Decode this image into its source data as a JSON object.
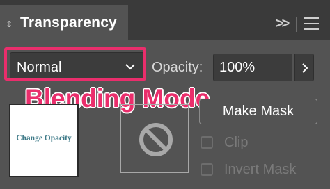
{
  "panel": {
    "title": "Transparency",
    "collapse_glyph": ">>",
    "menu_icon": "hamburger-menu-icon"
  },
  "blend_mode": {
    "selected": "Normal",
    "icon": "chevron-down-icon"
  },
  "opacity": {
    "label": "Opacity:",
    "value": "100%",
    "icon": "chevron-right-icon"
  },
  "annotation": {
    "caption": "Blending Mode",
    "color": "#ea2e6c"
  },
  "thumbnail": {
    "text": "Change Opacity"
  },
  "mask": {
    "icon": "no-mask-icon",
    "make_mask_label": "Make Mask",
    "clip_label": "Clip",
    "invert_label": "Invert Mask"
  }
}
